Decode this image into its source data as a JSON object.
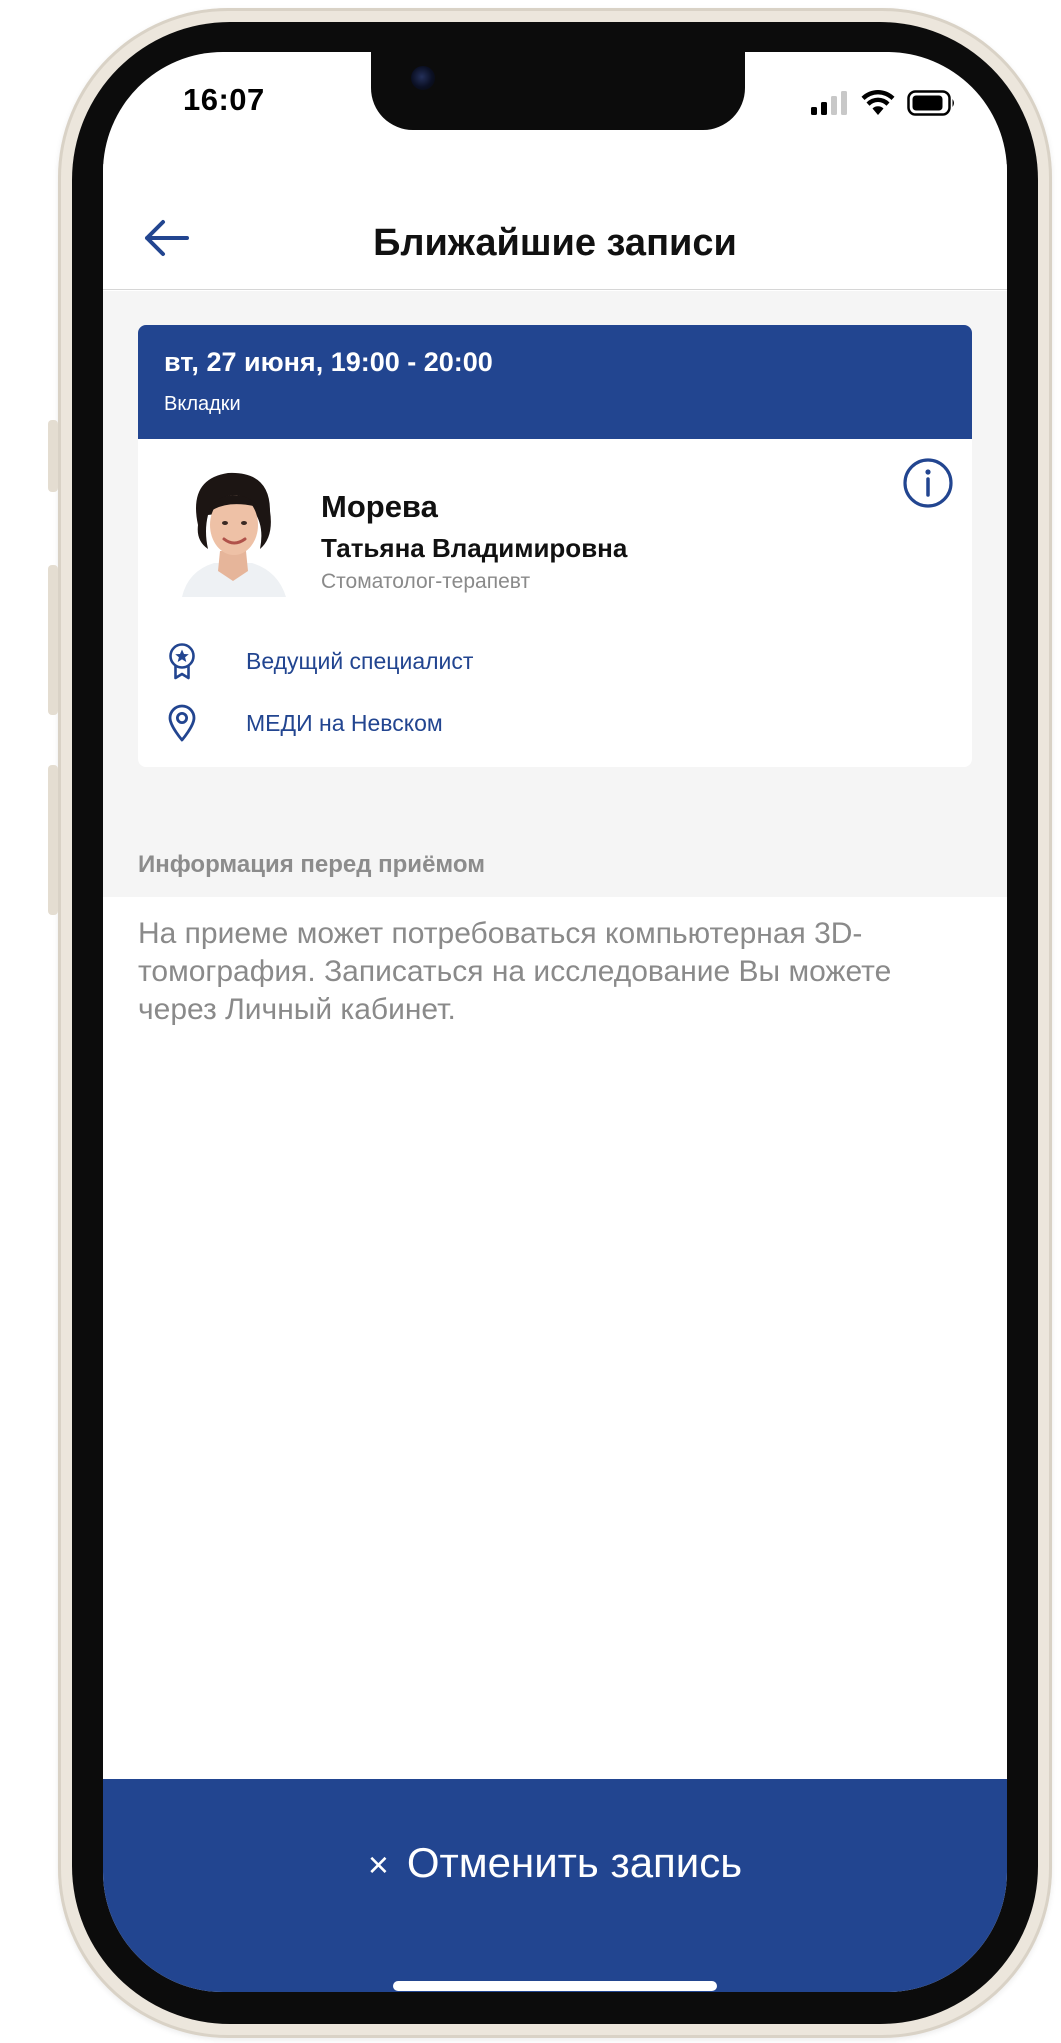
{
  "status_bar": {
    "time": "16:07"
  },
  "header": {
    "title": "Ближайшие записи"
  },
  "appointment": {
    "datetime": "вт, 27 июня, 19:00 - 20:00",
    "service": "Вкладки",
    "doctor": {
      "surname": "Морева",
      "given_names": "Татьяна Владимировна",
      "specialty": "Стоматолог-терапевт"
    },
    "rank": {
      "icon": "award-badge-icon",
      "label": "Ведущий специалист"
    },
    "clinic": {
      "icon": "location-pin-icon",
      "label": "МЕДИ на Невском"
    }
  },
  "pre_visit": {
    "heading": "Информация перед приёмом",
    "lines": [
      "На приеме может потребоваться компьютерная 3D-",
      "томография. Записаться на исследование Вы можете",
      "через Личный кабинет."
    ]
  },
  "footer": {
    "cancel_icon": "×",
    "cancel_label": "Отменить запись"
  },
  "colors": {
    "brand": "#224590",
    "muted_text": "#8a8a8a",
    "section_bg": "#f5f5f5"
  }
}
